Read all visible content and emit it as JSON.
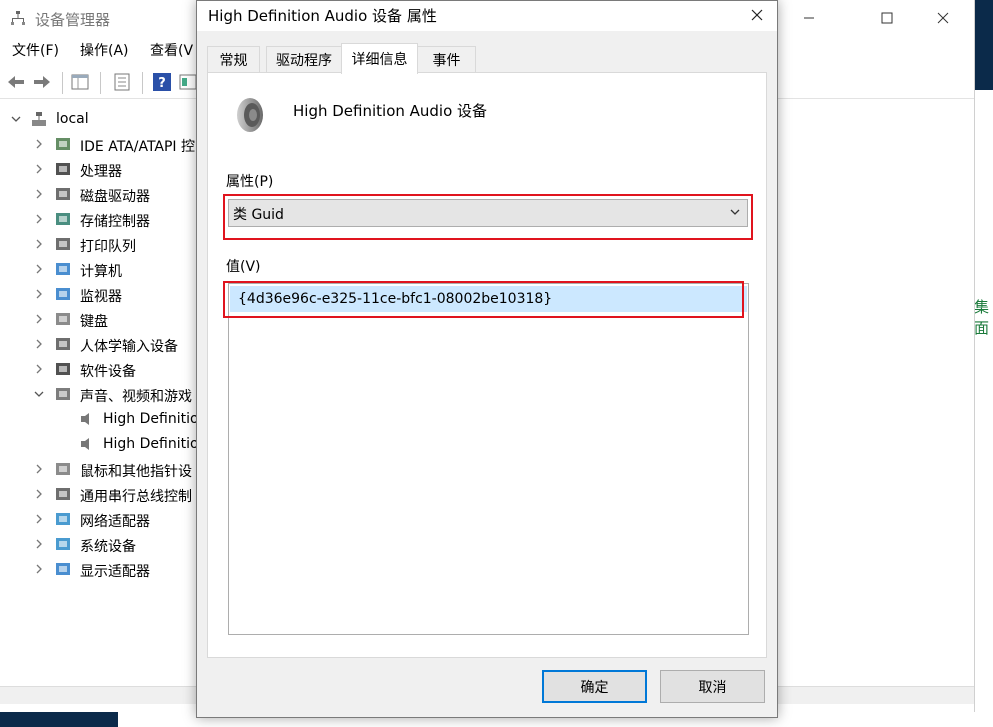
{
  "device_manager": {
    "title": "设备管理器",
    "menu": [
      "文件(F)",
      "操作(A)",
      "查看(V"
    ],
    "tree": {
      "root": "local",
      "items": [
        {
          "label": "IDE ATA/ATAPI 控",
          "icon": "ide-controller-icon"
        },
        {
          "label": "处理器",
          "icon": "processor-icon"
        },
        {
          "label": "磁盘驱动器",
          "icon": "disk-drive-icon"
        },
        {
          "label": "存储控制器",
          "icon": "storage-controller-icon"
        },
        {
          "label": "打印队列",
          "icon": "printer-icon"
        },
        {
          "label": "计算机",
          "icon": "computer-icon"
        },
        {
          "label": "监视器",
          "icon": "monitor-icon"
        },
        {
          "label": "键盘",
          "icon": "keyboard-icon"
        },
        {
          "label": "人体学输入设备",
          "icon": "hid-icon"
        },
        {
          "label": "软件设备",
          "icon": "software-device-icon"
        },
        {
          "label": "声音、视频和游戏",
          "icon": "speaker-icon",
          "expanded": true
        },
        {
          "label": "鼠标和其他指针设",
          "icon": "mouse-icon"
        },
        {
          "label": "通用串行总线控制",
          "icon": "usb-icon"
        },
        {
          "label": "网络适配器",
          "icon": "network-adapter-icon"
        },
        {
          "label": "系统设备",
          "icon": "system-device-icon"
        },
        {
          "label": "显示适配器",
          "icon": "display-adapter-icon"
        }
      ],
      "children": [
        "High Definitio",
        "High Definitio"
      ]
    }
  },
  "dialog": {
    "title": "High Definition Audio 设备 属性",
    "tabs": [
      "常规",
      "驱动程序",
      "详细信息",
      "事件"
    ],
    "active_tab": 2,
    "device_name": "High Definition Audio 设备",
    "property_label": "属性(P)",
    "property_value": "类 Guid",
    "value_label": "值(V)",
    "value_item": "{4d36e96c-e325-11ce-bfc1-08002be10318}",
    "ok_label": "确定",
    "cancel_label": "取消"
  },
  "background": {
    "green_text": "集面"
  },
  "colors": {
    "highlight_row": "#cce8ff",
    "annotation_red": "#e0141e",
    "default_button_border": "#0078d7"
  }
}
